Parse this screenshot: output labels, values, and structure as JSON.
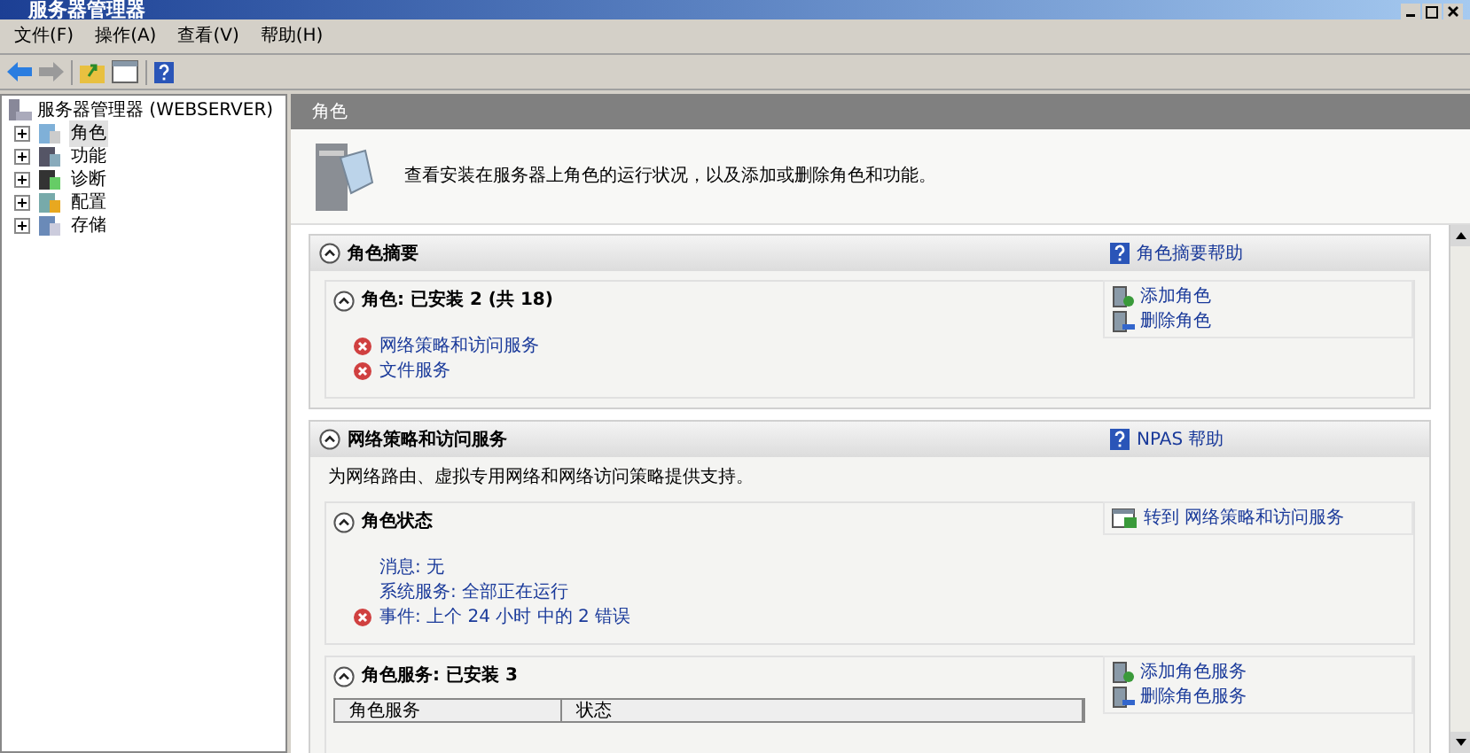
{
  "window": {
    "title": "服务器管理器"
  },
  "menu": [
    "文件(F)",
    "操作(A)",
    "查看(V)",
    "帮助(H)"
  ],
  "tree": {
    "label": "服务器管理器 (WEBSERVER)",
    "children": [
      {
        "label": "角色",
        "selected": true,
        "kind": "roles"
      },
      {
        "label": "功能",
        "selected": false,
        "kind": "features"
      },
      {
        "label": "诊断",
        "selected": false,
        "kind": "diagnostics"
      },
      {
        "label": "配置",
        "selected": false,
        "kind": "config"
      },
      {
        "label": "存储",
        "selected": false,
        "kind": "storage"
      }
    ]
  },
  "pane": {
    "title": "角色",
    "intro": "查看安装在服务器上角色的运行状况，以及添加或删除角色和功能。"
  },
  "sections": [
    {
      "title": "角色摘要",
      "help": "角色摘要帮助",
      "blocks": [
        {
          "title": "角色: 已安装 2 (共 18)",
          "items": [
            {
              "text": "网络策略和访问服务",
              "error": true
            },
            {
              "text": "文件服务",
              "error": true
            }
          ],
          "actions": [
            {
              "label": "添加角色",
              "kind": "add"
            },
            {
              "label": "删除角色",
              "kind": "remove"
            }
          ]
        }
      ]
    },
    {
      "title": "网络策略和访问服务",
      "help": "NPAS 帮助",
      "description": "为网络路由、虚拟专用网络和网络访问策略提供支持。",
      "blocks": [
        {
          "title": "角色状态",
          "items": [
            {
              "text": "消息: 无",
              "error": false
            },
            {
              "text": "系统服务: 全部正在运行",
              "error": false
            },
            {
              "text": "事件: 上个 24 小时 中的 2 错误",
              "error": true
            }
          ],
          "actions": [
            {
              "label": "转到 网络策略和访问服务",
              "kind": "goto"
            }
          ]
        },
        {
          "title": "角色服务: 已安装 3",
          "table": {
            "columns": [
              "角色服务",
              "状态"
            ]
          },
          "actions": [
            {
              "label": "添加角色服务",
              "kind": "add"
            },
            {
              "label": "删除角色服务",
              "kind": "remove"
            }
          ]
        }
      ]
    }
  ]
}
